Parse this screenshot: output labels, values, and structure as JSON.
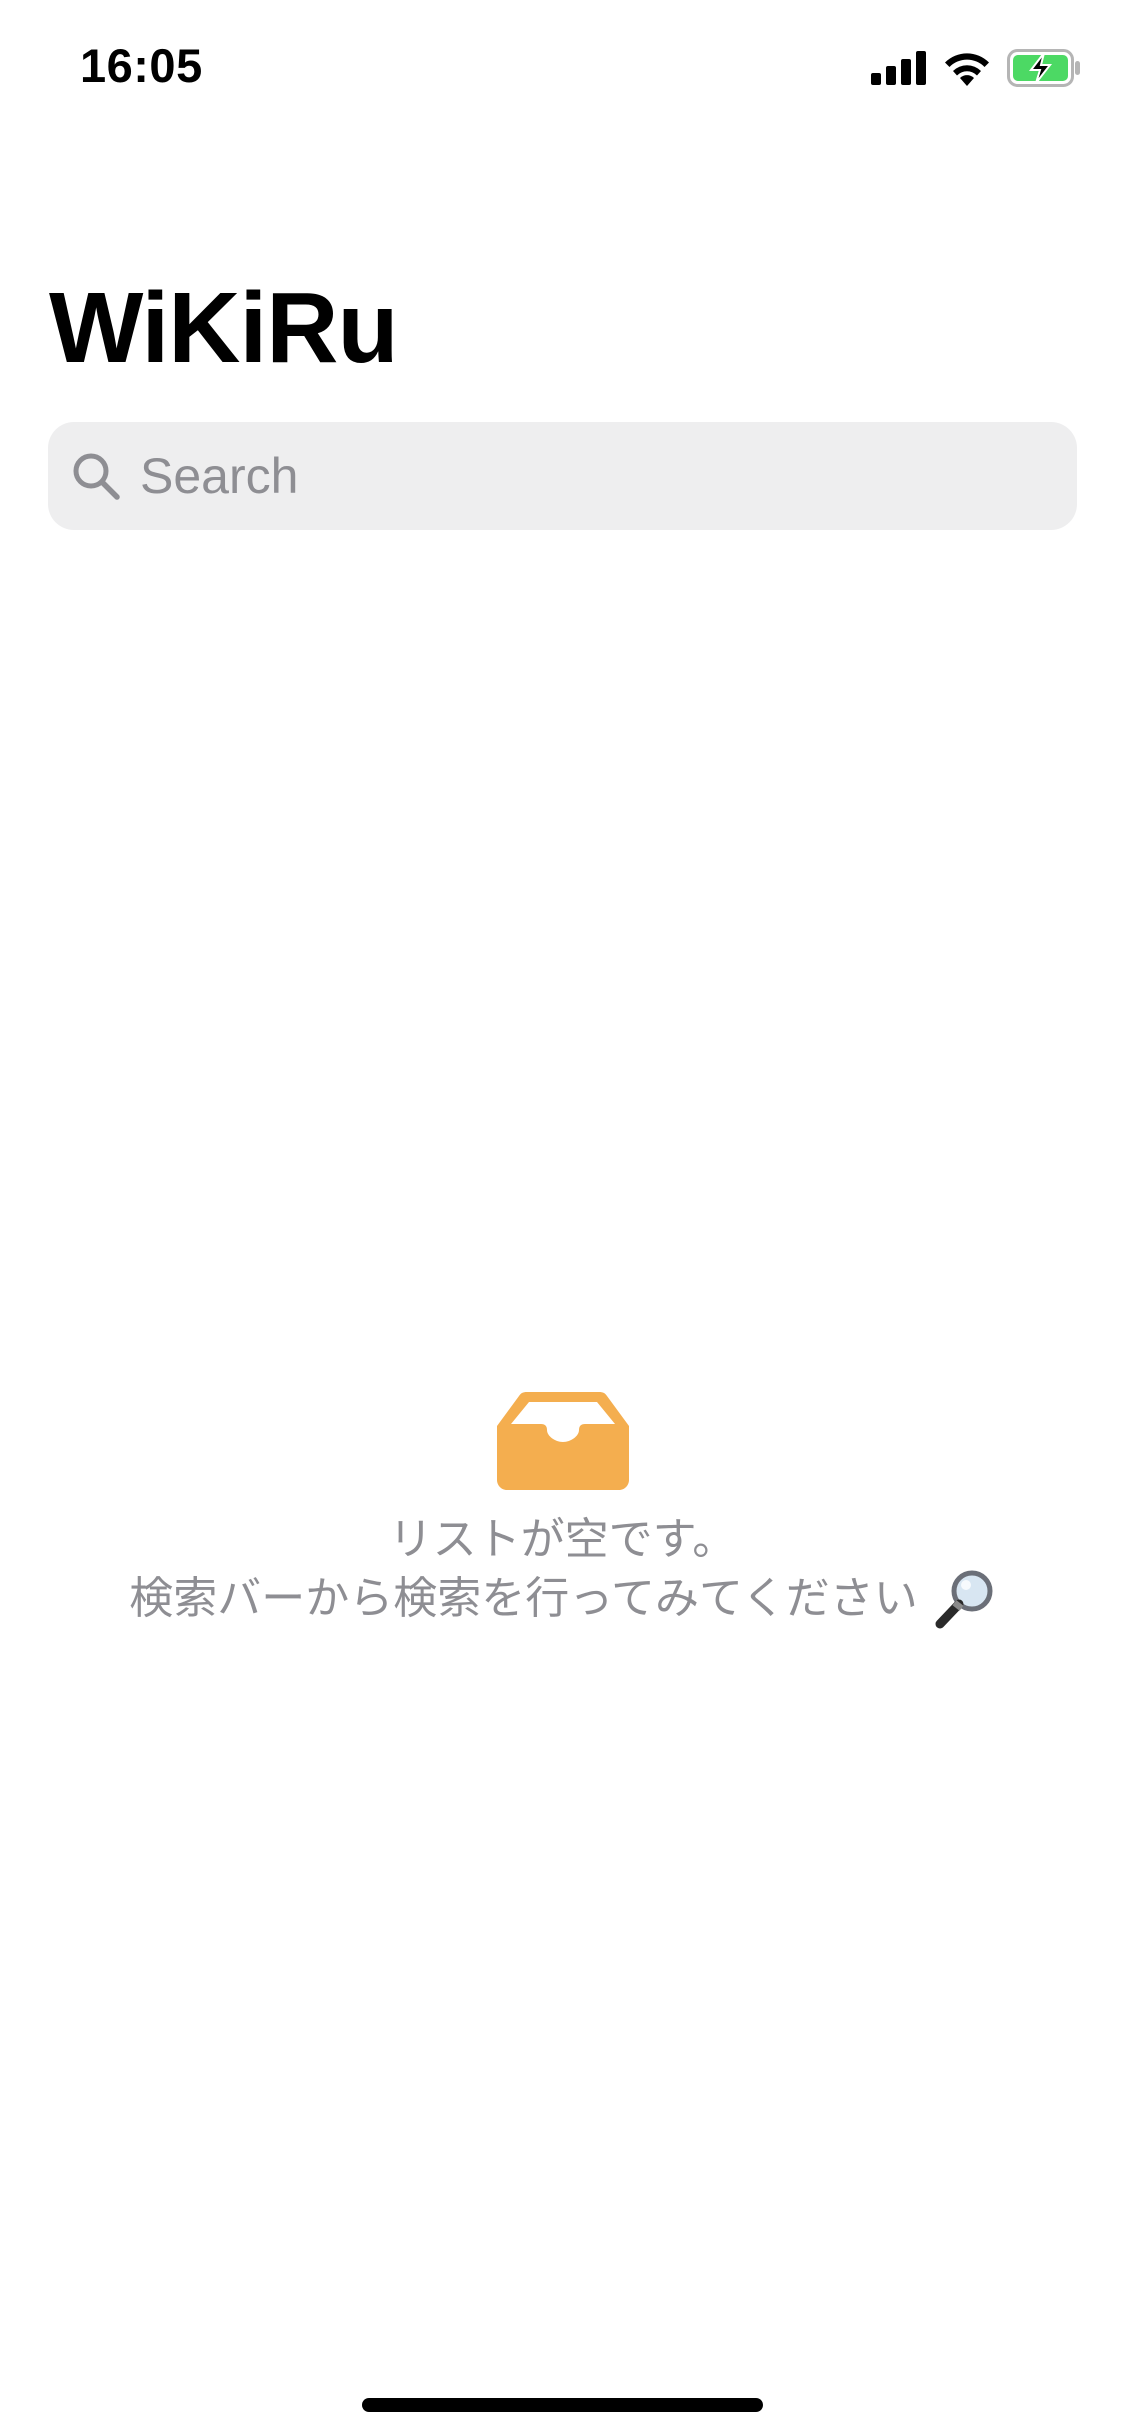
{
  "status_bar": {
    "time": "16:05",
    "icons": [
      "signal-icon",
      "wifi-icon",
      "battery-charging-icon"
    ],
    "battery_color": "#4cd964"
  },
  "header": {
    "title": "WiKiRu"
  },
  "search": {
    "placeholder": "Search",
    "value": ""
  },
  "empty_state": {
    "icon": "tray-icon",
    "icon_color": "#f4ae4f",
    "line1": "リストが空です。",
    "line2": "検索バーから検索を行ってみてください",
    "trailing_icon": "magnifier-icon"
  }
}
